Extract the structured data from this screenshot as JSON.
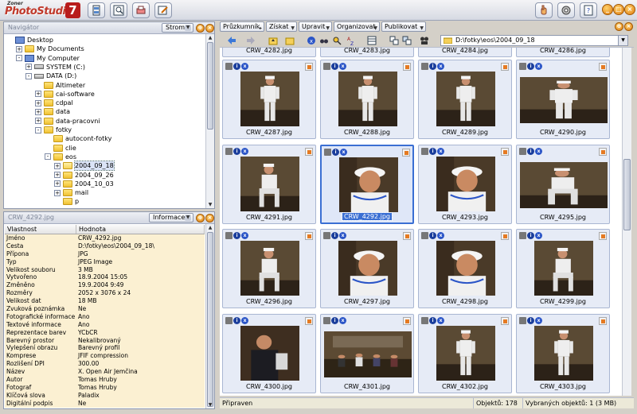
{
  "app": {
    "brand_small": "Zoner",
    "brand": "PhotoStudio",
    "version": "7"
  },
  "navigator": {
    "title": "Navigátor",
    "combo": "Strom",
    "items": [
      {
        "label": "Desktop",
        "level": 0,
        "pm": "",
        "icon": "desktop"
      },
      {
        "label": "My Documents",
        "level": 1,
        "pm": "+",
        "icon": "folder"
      },
      {
        "label": "My Computer",
        "level": 1,
        "pm": "-",
        "icon": "computer"
      },
      {
        "label": "SYSTEM (C:)",
        "level": 2,
        "pm": "+",
        "icon": "drive"
      },
      {
        "label": "DATA (D:)",
        "level": 2,
        "pm": "-",
        "icon": "drive"
      },
      {
        "label": "Altimeter",
        "level": 3,
        "pm": "",
        "icon": "folder"
      },
      {
        "label": "cai-software",
        "level": 3,
        "pm": "+",
        "icon": "folder"
      },
      {
        "label": "cdpal",
        "level": 3,
        "pm": "+",
        "icon": "folder"
      },
      {
        "label": "data",
        "level": 3,
        "pm": "+",
        "icon": "folder"
      },
      {
        "label": "data-pracovni",
        "level": 3,
        "pm": "+",
        "icon": "folder"
      },
      {
        "label": "fotky",
        "level": 3,
        "pm": "-",
        "icon": "folder"
      },
      {
        "label": "autocont-fotky",
        "level": 4,
        "pm": "",
        "icon": "folder"
      },
      {
        "label": "clie",
        "level": 4,
        "pm": "",
        "icon": "folder"
      },
      {
        "label": "eos",
        "level": 4,
        "pm": "-",
        "icon": "folder"
      },
      {
        "label": "2004_09_18",
        "level": 5,
        "pm": "+",
        "icon": "folder-open",
        "selected": true
      },
      {
        "label": "2004_09_26",
        "level": 5,
        "pm": "+",
        "icon": "folder"
      },
      {
        "label": "2004_10_03",
        "level": 5,
        "pm": "+",
        "icon": "folder"
      },
      {
        "label": "mail",
        "level": 5,
        "pm": "+",
        "icon": "folder"
      },
      {
        "label": "p",
        "level": 5,
        "pm": "",
        "icon": "folder"
      }
    ]
  },
  "info": {
    "title": "CRW_4292.jpg",
    "combo": "Informace",
    "col_property": "Vlastnost",
    "col_value": "Hodnota",
    "rows": [
      [
        "Jméno",
        "CRW_4292.jpg"
      ],
      [
        "Cesta",
        "D:\\fotky\\eos\\2004_09_18\\"
      ],
      [
        "Přípona",
        "JPG"
      ],
      [
        "Typ",
        "JPEG Image"
      ],
      [
        "Velikost souboru",
        "3 MB"
      ],
      [
        "Vytvořeno",
        "18.9.2004 15:05"
      ],
      [
        "Změněno",
        "19.9.2004 9:49"
      ],
      [
        "Rozměry",
        "2052 x 3076 x 24"
      ],
      [
        "Velikost dat",
        "18 MB"
      ],
      [
        "Zvuková poznámka",
        "Ne"
      ],
      [
        "Fotografické informace",
        "Ano"
      ],
      [
        "Textové informace",
        "Ano"
      ],
      [
        "Reprezentace barev",
        "YCbCR"
      ],
      [
        "Barevný prostor",
        "Nekalibrovaný"
      ],
      [
        "Vylepšení obrazu",
        "Barevný profil"
      ],
      [
        "Komprese",
        "JFIF compression"
      ],
      [
        "Rozlišení DPI",
        "300.00"
      ],
      [
        "Název",
        "X. Open Air Jemčina"
      ],
      [
        "Autor",
        "Tomas Hruby"
      ],
      [
        "Fotograf",
        "Tomas Hruby"
      ],
      [
        "Klíčová slova",
        "Paladix"
      ],
      [
        "Digitální podpis",
        "Ne"
      ]
    ]
  },
  "menus": [
    "Průzkumník",
    "Získat",
    "Upravit",
    "Organizovat",
    "Publikovat"
  ],
  "path": "D:\\fotky\\eos\\2004_09_18",
  "top_row": [
    "CRW_4282.jpg",
    "CRW_4283.jpg",
    "CRW_4284.jpg",
    "CRW_4286.jpg"
  ],
  "thumbnails": [
    {
      "name": "CRW_4287.jpg",
      "pose": "full"
    },
    {
      "name": "CRW_4288.jpg",
      "pose": "full"
    },
    {
      "name": "CRW_4289.jpg",
      "pose": "full"
    },
    {
      "name": "CRW_4290.jpg",
      "pose": "full-land"
    },
    {
      "name": "CRW_4291.jpg",
      "pose": "sit"
    },
    {
      "name": "CRW_4292.jpg",
      "pose": "face",
      "selected": true
    },
    {
      "name": "CRW_4293.jpg",
      "pose": "face"
    },
    {
      "name": "CRW_4295.jpg",
      "pose": "sit-land"
    },
    {
      "name": "CRW_4296.jpg",
      "pose": "sit"
    },
    {
      "name": "CRW_4297.jpg",
      "pose": "face"
    },
    {
      "name": "CRW_4298.jpg",
      "pose": "face"
    },
    {
      "name": "CRW_4299.jpg",
      "pose": "sit"
    },
    {
      "name": "CRW_4300.jpg",
      "pose": "dark"
    },
    {
      "name": "CRW_4301.jpg",
      "pose": "crowd"
    },
    {
      "name": "CRW_4302.jpg",
      "pose": "full"
    },
    {
      "name": "CRW_4303.jpg",
      "pose": "full"
    }
  ],
  "status": {
    "ready": "Připraven",
    "objects": "Objektů: 178",
    "selected": "Vybraných objektů: 1 (3 MB)"
  }
}
